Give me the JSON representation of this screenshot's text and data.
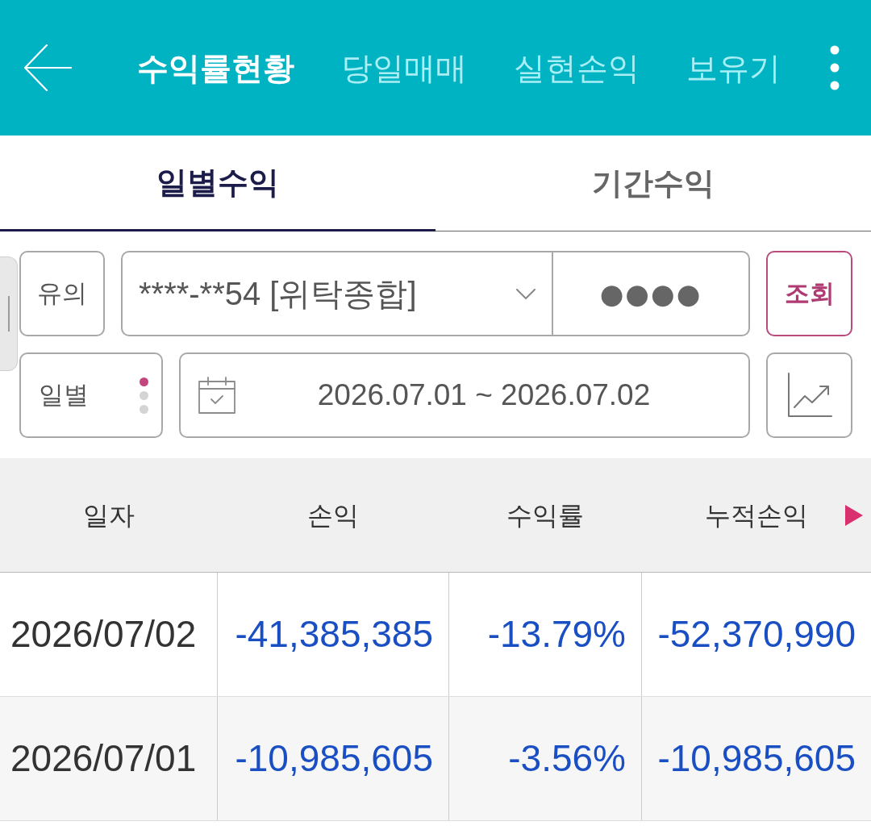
{
  "header": {
    "tabs": [
      {
        "label": "수익률현황",
        "selected": true
      },
      {
        "label": "당일매매",
        "selected": false
      },
      {
        "label": "실현손익",
        "selected": false
      },
      {
        "label": "보유기",
        "selected": false
      }
    ]
  },
  "sub_tabs": [
    {
      "label": "일별수익",
      "selected": true
    },
    {
      "label": "기간수익",
      "selected": false
    }
  ],
  "filters": {
    "notice_button": "유의",
    "account": {
      "value": "****-**54 [위탁종합]"
    },
    "password": {
      "value": "●●●●"
    },
    "search_button": "조회",
    "period": {
      "value": "일별",
      "options": [
        {
          "selected": true
        },
        {
          "selected": false
        },
        {
          "selected": false
        }
      ]
    },
    "date_range": {
      "value": "2026.07.01 ~ 2026.07.02"
    }
  },
  "table": {
    "columns": [
      "일자",
      "손익",
      "수익률",
      "누적손익"
    ],
    "more_columns": true,
    "rows": [
      {
        "loss": true,
        "cells": [
          "2026/07/02",
          "-41,385,385",
          "-13.79%",
          "-52,370,990"
        ]
      },
      {
        "loss": true,
        "cells": [
          "2026/07/01",
          "-10,985,605",
          "-3.56%",
          "-10,985,605"
        ]
      }
    ]
  }
}
